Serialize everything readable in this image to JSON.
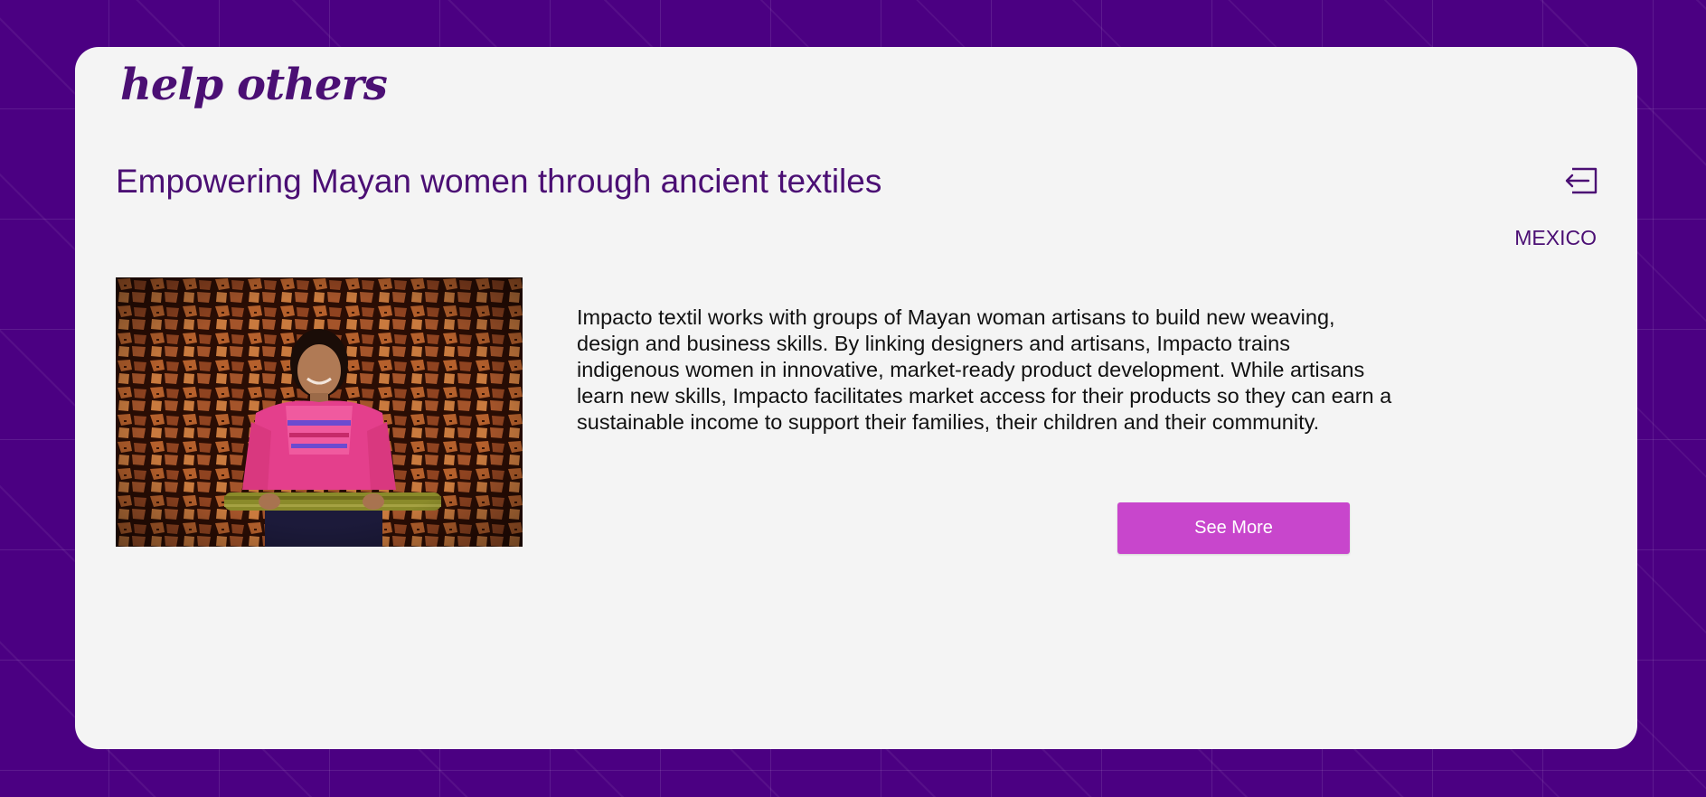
{
  "brand": {
    "logo_text": "help others"
  },
  "project": {
    "title": "Empowering Mayan women through ancient textiles",
    "country": "MEXICO",
    "description": "Impacto textil works with groups of Mayan woman artisans to build new weaving, design and business skills. By linking designers and artisans, Impacto trains indigenous women in innovative, market-ready product development. While artisans learn new skills, Impacto facilitates market access for their products so they can earn a sustainable income to support their families, their children and their community.",
    "cta_label": "See More"
  },
  "icons": {
    "exit": "exit-icon"
  },
  "colors": {
    "background": "#4b0082",
    "card": "#f4f4f4",
    "brand_text": "#4b0f74",
    "button": "#c846cc",
    "button_text": "#ffffff"
  }
}
